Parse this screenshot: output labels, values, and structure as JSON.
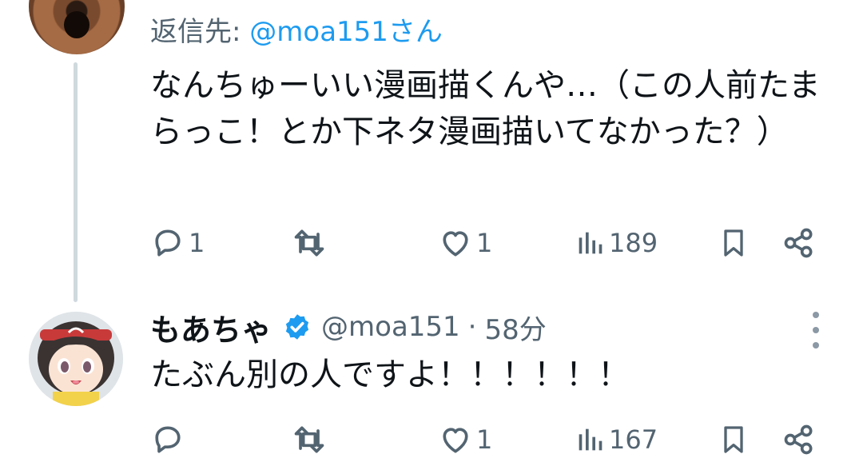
{
  "tweet1": {
    "reply_prefix": "返信先: ",
    "reply_handle": "@moa151さん",
    "text": "なんちゅーいい漫画描くんや…（この人前たまらっこ！とか下ネタ漫画描いてなかった？）",
    "actions": {
      "reply_count": "1",
      "retweet_count": "",
      "like_count": "1",
      "view_count": "189"
    }
  },
  "tweet2": {
    "author_name": "もあちゃ",
    "author_handle": "@moa151",
    "separator": "·",
    "time": "58分",
    "text": "たぶん別の人ですよ！！！！！！",
    "actions": {
      "reply_count": "",
      "retweet_count": "",
      "like_count": "1",
      "view_count": "167"
    }
  },
  "icons": {
    "reply": "reply-icon",
    "retweet": "retweet-icon",
    "like": "heart-icon",
    "views": "views-icon",
    "bookmark": "bookmark-icon",
    "share": "share-icon",
    "verified": "verified-badge-icon",
    "more": "more-options-icon"
  },
  "colors": {
    "text": "#0f1419",
    "secondary": "#536471",
    "link": "#1d9bf0",
    "verified": "#1d9bf0",
    "thread_line": "#cfd9de"
  }
}
